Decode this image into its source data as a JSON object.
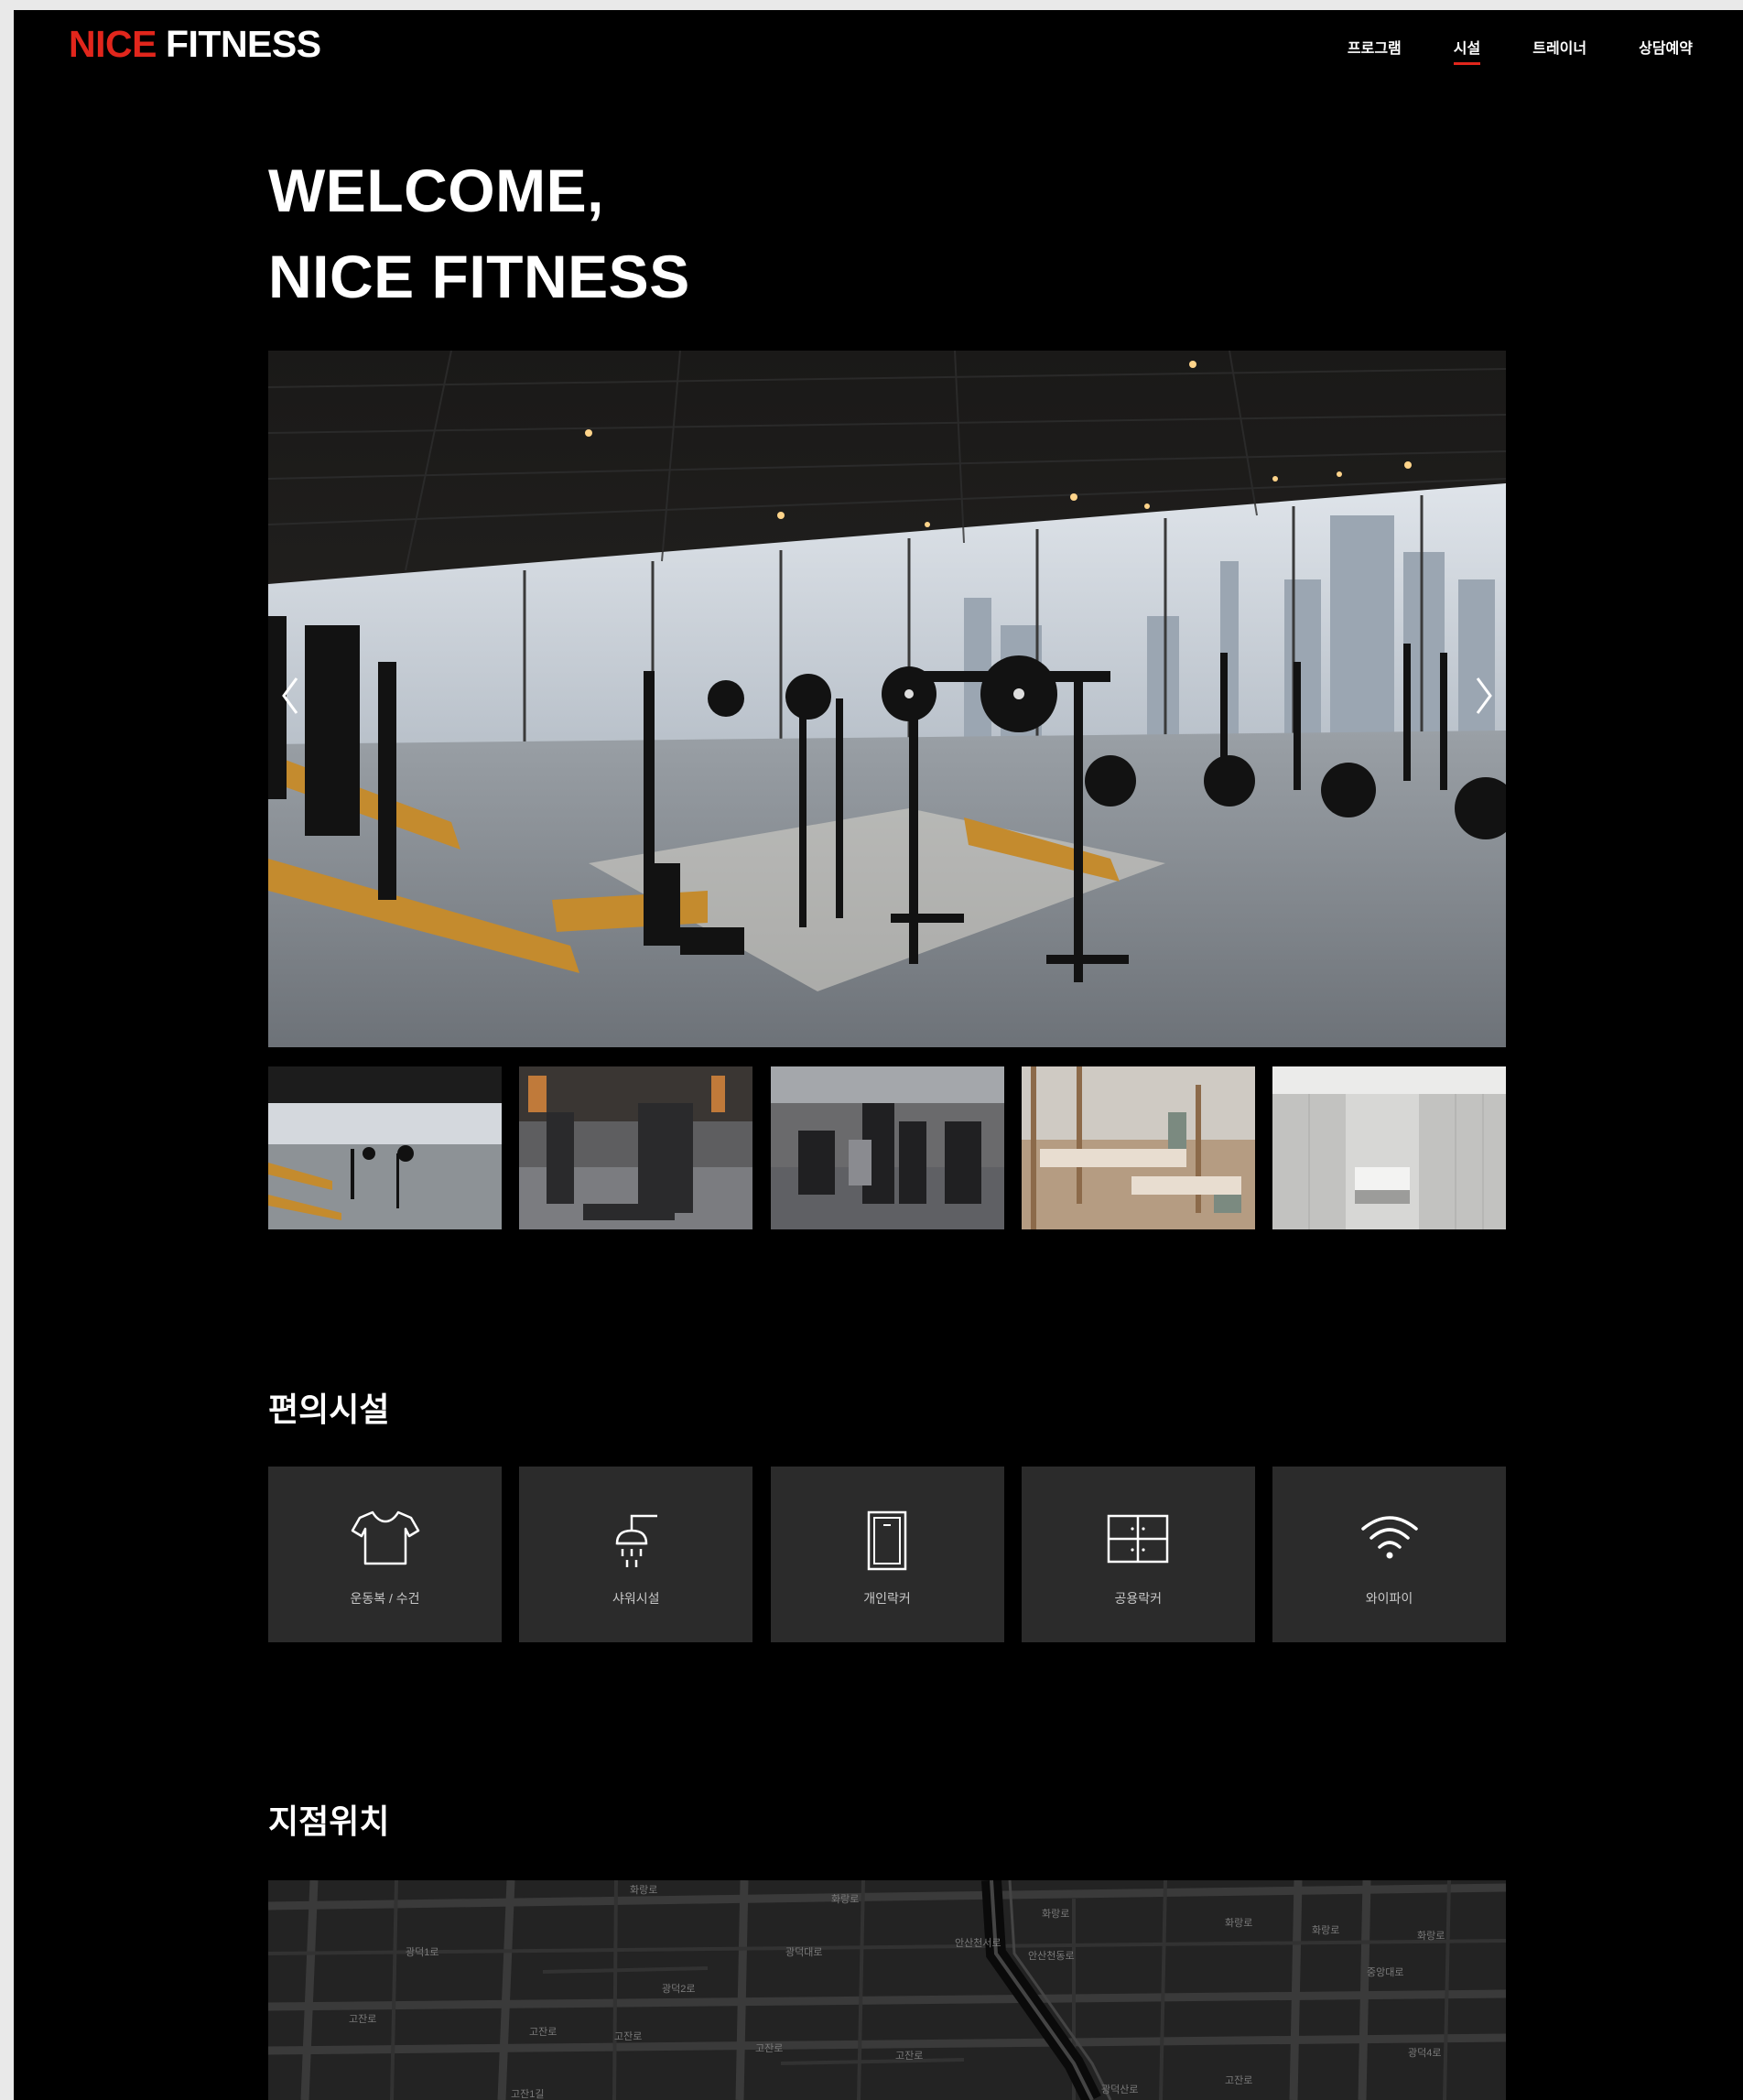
{
  "header": {
    "logo_part1": "NICE",
    "logo_part2": "FITNESS",
    "nav": [
      "프로그램",
      "시설",
      "트레이너",
      "상담예약"
    ],
    "active_nav": "시설"
  },
  "hero": {
    "line1": "WELCOME,",
    "line2": "NICE FITNESS"
  },
  "gallery": {
    "prev_icon": "chevron-left-icon",
    "next_icon": "chevron-right-icon",
    "thumbnails": [
      "weight-area",
      "machine-area",
      "strength-area",
      "pilates-studio",
      "locker-room"
    ]
  },
  "amenities": {
    "title": "편의시설",
    "items": [
      {
        "label": "운동복 / 수건",
        "icon": "tshirt-icon"
      },
      {
        "label": "샤워시설",
        "icon": "shower-icon"
      },
      {
        "label": "개인락커",
        "icon": "locker-icon"
      },
      {
        "label": "공용락커",
        "icon": "shared-locker-icon"
      },
      {
        "label": "와이파이",
        "icon": "wifi-icon"
      }
    ]
  },
  "location": {
    "title": "지점위치",
    "map_labels": [
      "화랑로",
      "화랑로",
      "화랑로",
      "화랑로",
      "화랑로",
      "화랑로",
      "고잔로",
      "고잔로",
      "고잔로",
      "고잔로",
      "고잔로",
      "고잔로",
      "고잔1길",
      "안산천서로",
      "안산천동로",
      "광덕대로",
      "광덕1로",
      "광덕2로",
      "중앙대로",
      "광덕산로",
      "광덕4로"
    ]
  },
  "colors": {
    "accent": "#e1261c",
    "background": "#000000",
    "card": "#2b2b2b"
  }
}
